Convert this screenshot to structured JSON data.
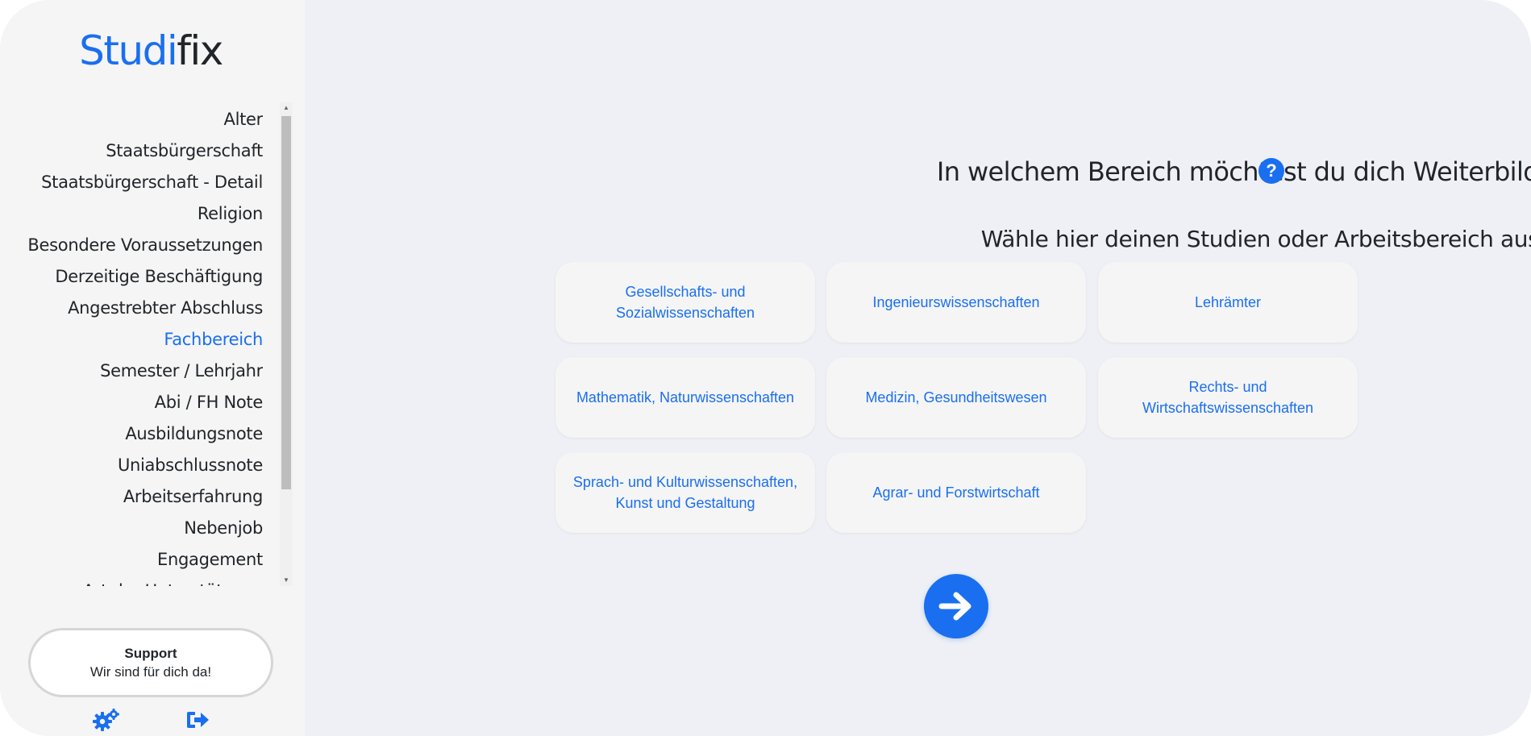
{
  "brand": {
    "part1": "Studi",
    "part2": "fix",
    "accent_color": "#1a6ff0"
  },
  "sidebar": {
    "items": [
      {
        "label": "Alter",
        "active": false
      },
      {
        "label": "Staatsbürgerschaft",
        "active": false
      },
      {
        "label": "Staatsbürgerschaft - Detail",
        "active": false
      },
      {
        "label": "Religion",
        "active": false
      },
      {
        "label": "Besondere Voraussetzungen",
        "active": false
      },
      {
        "label": "Derzeitige Beschäftigung",
        "active": false
      },
      {
        "label": "Angestrebter Abschluss",
        "active": false
      },
      {
        "label": "Fachbereich",
        "active": true
      },
      {
        "label": "Semester / Lehrjahr",
        "active": false
      },
      {
        "label": "Abi / FH Note",
        "active": false
      },
      {
        "label": "Ausbildungsnote",
        "active": false
      },
      {
        "label": "Uniabschlussnote",
        "active": false
      },
      {
        "label": "Arbeitserfahrung",
        "active": false
      },
      {
        "label": "Nebenjob",
        "active": false
      },
      {
        "label": "Engagement",
        "active": false
      },
      {
        "label": "Art der Unterstützung",
        "active": false
      }
    ],
    "support": {
      "title": "Support",
      "subtitle": "Wir sind für dich da!"
    },
    "footer_icons": [
      "gears-icon",
      "sign-out-icon"
    ]
  },
  "main": {
    "title": "In welchem Bereich möchtest du dich Weiterbilden?",
    "help_icon": "question-circle-icon",
    "subtitle": "Wähle hier deinen Studien oder Arbeitsbereich aus",
    "options": [
      {
        "label": "Gesellschafts- und Sozialwissenschaften"
      },
      {
        "label": "Ingenieurswissenschaften"
      },
      {
        "label": "Lehrämter"
      },
      {
        "label": "Mathematik, Naturwissenschaften"
      },
      {
        "label": "Medizin, Gesundheitswesen"
      },
      {
        "label": "Rechts- und Wirtschaftswissenschaften"
      },
      {
        "label": "Sprach- und Kulturwissenschaften, Kunst und Gestaltung"
      },
      {
        "label": "Agrar- und Forstwirtschaft"
      }
    ],
    "next_icon": "arrow-right-icon"
  }
}
